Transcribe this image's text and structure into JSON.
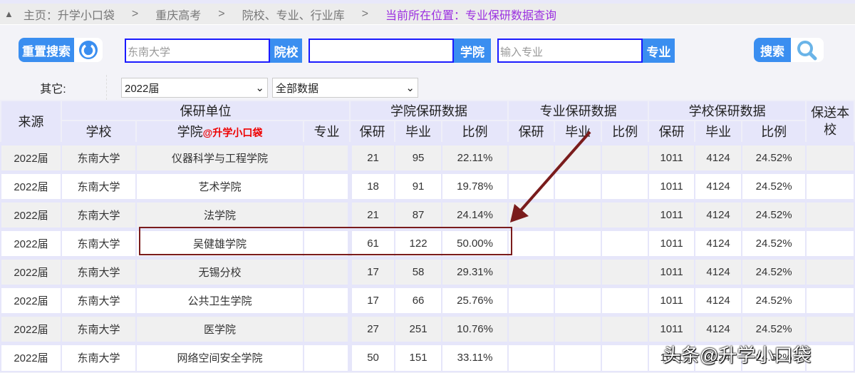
{
  "breadcrumb": {
    "items": [
      "主页：升学小口袋",
      "重庆高考",
      "院校、专业、行业库"
    ],
    "separator": ">",
    "current": "当前所在位置：专业保研数据查询"
  },
  "search": {
    "reset_label": "重置搜索",
    "school_value": "东南大学",
    "school_tag": "院校",
    "college_value": "",
    "college_tag": "学院",
    "major_placeholder": "输入专业",
    "major_tag": "专业",
    "search_label": "搜索"
  },
  "filters": {
    "label": "其它:",
    "year": "2022届",
    "scope": "全部数据"
  },
  "table": {
    "group_headers": {
      "source": "来源",
      "unit": "保研单位",
      "college_data": "学院保研数据",
      "major_data": "专业保研数据",
      "school_data": "学校保研数据",
      "recommend": "保送本校"
    },
    "sub_headers": {
      "school": "学校",
      "college": "学院",
      "college_watermark": "@升学小口袋",
      "major": "专业",
      "baoyan": "保研",
      "grad": "毕业",
      "ratio": "比例"
    },
    "rows": [
      {
        "source": "2022届",
        "school": "东南大学",
        "college": "仪器科学与工程学院",
        "cb": "21",
        "cg": "95",
        "cr": "22.11%",
        "sb": "1011",
        "sg": "4124",
        "sr": "24.52%"
      },
      {
        "source": "2022届",
        "school": "东南大学",
        "college": "艺术学院",
        "cb": "18",
        "cg": "91",
        "cr": "19.78%",
        "sb": "1011",
        "sg": "4124",
        "sr": "24.52%"
      },
      {
        "source": "2022届",
        "school": "东南大学",
        "college": "法学院",
        "cb": "21",
        "cg": "87",
        "cr": "24.14%",
        "sb": "1011",
        "sg": "4124",
        "sr": "24.52%"
      },
      {
        "source": "2022届",
        "school": "东南大学",
        "college": "吴健雄学院",
        "cb": "61",
        "cg": "122",
        "cr": "50.00%",
        "sb": "1011",
        "sg": "4124",
        "sr": "24.52%"
      },
      {
        "source": "2022届",
        "school": "东南大学",
        "college": "无锡分校",
        "cb": "17",
        "cg": "58",
        "cr": "29.31%",
        "sb": "1011",
        "sg": "4124",
        "sr": "24.52%"
      },
      {
        "source": "2022届",
        "school": "东南大学",
        "college": "公共卫生学院",
        "cb": "17",
        "cg": "66",
        "cr": "25.76%",
        "sb": "1011",
        "sg": "4124",
        "sr": "24.52%"
      },
      {
        "source": "2022届",
        "school": "东南大学",
        "college": "医学院",
        "cb": "27",
        "cg": "251",
        "cr": "10.76%",
        "sb": "1011",
        "sg": "4124",
        "sr": "24.52%"
      },
      {
        "source": "2022届",
        "school": "东南大学",
        "college": "网络空间安全学院",
        "cb": "50",
        "cg": "151",
        "cr": "33.11%",
        "sb": "1011",
        "sg": "4124",
        "sr": "24.52%"
      }
    ]
  },
  "watermark": "头条@升学小口袋"
}
